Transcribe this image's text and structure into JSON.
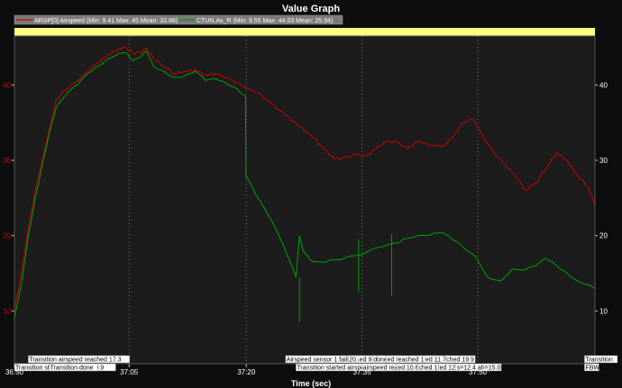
{
  "chart_data": {
    "type": "line",
    "title": "Value Graph",
    "xlabel": "Time (sec)",
    "ylabel": "",
    "xlim": [
      36.5,
      38.17
    ],
    "ylim": [
      3,
      46.5
    ],
    "grid": true,
    "legend_position": "top",
    "x_ticks": [
      {
        "value": 36.5,
        "label": "36:50"
      },
      {
        "value": 36.83,
        "label": "37:05"
      },
      {
        "value": 37.167,
        "label": "37:20"
      },
      {
        "value": 37.5,
        "label": "37:35"
      },
      {
        "value": 37.833,
        "label": "37:50"
      }
    ],
    "y_ticks": [
      10,
      20,
      30,
      40
    ],
    "y_tick_labels": [
      "10",
      "20",
      "30",
      "40"
    ],
    "series": [
      {
        "name": "ARSP[0] Airspeed",
        "legend": "ARSP[0] Airspeed (Min: 9.41 Max: 45 Mean: 33.88)",
        "color": "#cc0000",
        "axis": "left",
        "x": [
          36.5,
          36.52,
          36.54,
          36.56,
          36.58,
          36.6,
          36.62,
          36.65,
          36.68,
          36.71,
          36.74,
          36.77,
          36.8,
          36.82,
          36.84,
          36.86,
          36.88,
          36.9,
          36.93,
          36.96,
          36.99,
          37.02,
          37.05,
          37.08,
          37.11,
          37.14,
          37.17,
          37.2,
          37.24,
          37.28,
          37.32,
          37.36,
          37.39,
          37.42,
          37.45,
          37.48,
          37.51,
          37.54,
          37.57,
          37.6,
          37.63,
          37.66,
          37.7,
          37.73,
          37.76,
          37.79,
          37.82,
          37.85,
          37.88,
          37.91,
          37.94,
          37.97,
          38.0,
          38.03,
          38.06,
          38.09,
          38.12,
          38.15,
          38.17
        ],
        "values": [
          10,
          15,
          21,
          26,
          30,
          34,
          38,
          39.5,
          40.5,
          41.8,
          43,
          44,
          44.8,
          45,
          44.2,
          44.3,
          44.8,
          43.5,
          42.5,
          41.5,
          41.8,
          42,
          41.3,
          41.5,
          41,
          40.3,
          39.5,
          39,
          37.5,
          36,
          34.5,
          33,
          31.5,
          30.2,
          30.3,
          30.8,
          30.5,
          31.5,
          32.5,
          32.4,
          31.5,
          32.5,
          32,
          31.8,
          33,
          35,
          35.5,
          33,
          31,
          29.5,
          28,
          26,
          27,
          29,
          31,
          30,
          28,
          26.5,
          24
        ]
      },
      {
        "name": "CTUN.As",
        "legend": "CTUN.As_R (Min: 8.55 Max: 44.53 Mean: 25.94)",
        "color": "#00a000",
        "axis": "right",
        "x": [
          36.5,
          36.52,
          36.54,
          36.56,
          36.58,
          36.6,
          36.62,
          36.65,
          36.68,
          36.71,
          36.74,
          36.77,
          36.8,
          36.82,
          36.84,
          36.86,
          36.88,
          36.9,
          36.93,
          36.96,
          36.99,
          37.02,
          37.05,
          37.08,
          37.11,
          37.14,
          37.165,
          37.166,
          37.2,
          37.24,
          37.28,
          37.31,
          37.32,
          37.33,
          37.36,
          37.4,
          37.45,
          37.5,
          37.55,
          37.6,
          37.62,
          37.66,
          37.7,
          37.73,
          37.76,
          37.79,
          37.83,
          37.86,
          37.9,
          37.93,
          37.97,
          38.0,
          38.03,
          38.06,
          38.09,
          38.12,
          38.15,
          38.17
        ],
        "values": [
          9,
          13.5,
          20,
          25,
          29.5,
          33.5,
          37,
          38.8,
          40,
          41.5,
          42.5,
          43.5,
          44.2,
          44.3,
          43.2,
          43.6,
          44.5,
          42.5,
          41.8,
          41,
          41.2,
          41.8,
          40.6,
          40.8,
          40.2,
          39.5,
          38.5,
          28,
          25,
          22,
          18,
          14.5,
          20,
          18,
          16.5,
          16.6,
          17,
          17.5,
          18.5,
          19,
          19.6,
          20,
          20.2,
          20.4,
          19.5,
          18.5,
          17,
          14.5,
          14,
          15.5,
          15.5,
          16,
          17,
          16,
          15,
          14,
          13.5,
          13
        ]
      }
    ],
    "annotations": [
      {
        "x": 36.5,
        "row": "bottom",
        "text": "Transition started airspeed 19.9"
      },
      {
        "x": 36.54,
        "row": "top",
        "text": "Transition airspeed reached 17.3"
      },
      {
        "x": 36.6,
        "row": "bottom",
        "text": "Transition done"
      },
      {
        "x": 37.28,
        "row": "top",
        "text": "Airspeed sensor 1 failure. Disabling"
      },
      {
        "x": 37.31,
        "row": "bottom",
        "text": "Transition started airspeed 14.0"
      },
      {
        "x": 37.46,
        "row": "top",
        "text": "20.4"
      },
      {
        "x": 37.49,
        "row": "top",
        "text": "ed 9.2"
      },
      {
        "x": 37.53,
        "row": "top",
        "text": "done"
      },
      {
        "x": 37.5,
        "row": "bottom",
        "text": "airspeed reached 17.0"
      },
      {
        "x": 37.57,
        "row": "top",
        "text": "ed reached 17.9"
      },
      {
        "x": 37.6,
        "row": "bottom",
        "text": "ed 10.6"
      },
      {
        "x": 37.68,
        "row": "top",
        "text": "ed 11.7"
      },
      {
        "x": 37.66,
        "row": "bottom",
        "text": "ched 19.0"
      },
      {
        "x": 37.74,
        "row": "top",
        "text": "ched 19.9"
      },
      {
        "x": 37.72,
        "row": "bottom",
        "text": "ed 12.4"
      },
      {
        "x": 37.77,
        "row": "bottom",
        "text": "s=12.4 ah=15.0"
      },
      {
        "x": 38.14,
        "row": "top",
        "text": "Transition"
      },
      {
        "x": 38.14,
        "row": "bottom",
        "text": "FBWA"
      }
    ]
  }
}
